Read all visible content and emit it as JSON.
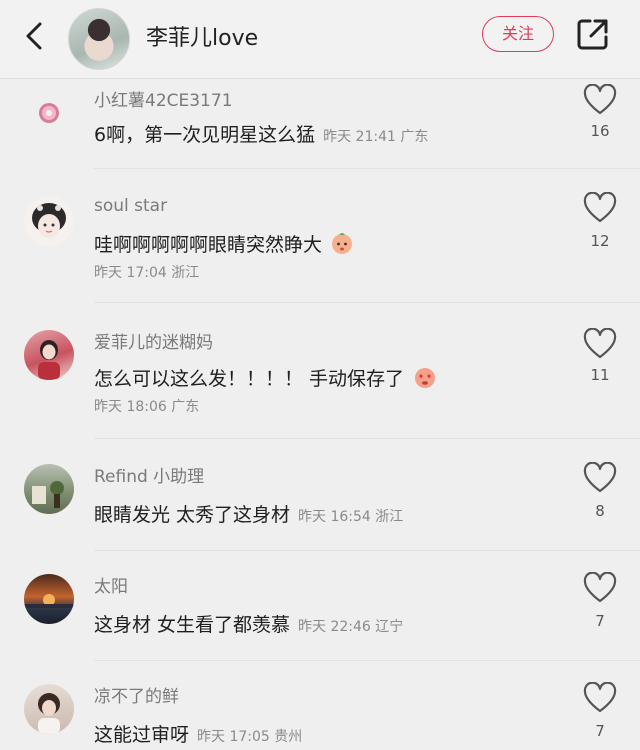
{
  "header": {
    "username": "李菲儿love",
    "follow_label": "关注"
  },
  "comments": [
    {
      "user": "小红薯42CE3171",
      "text": "6啊，第一次见明星这么猛",
      "time": "昨天 21:41 广东",
      "likes": "16"
    },
    {
      "user": "soul star",
      "text": "哇啊啊啊啊啊眼睛突然睁大",
      "time": "昨天 17:04 浙江",
      "likes": "12"
    },
    {
      "user": "爱菲儿的迷糊妈",
      "text": "怎么可以这么发！！！！ 手动保存了",
      "time": "昨天 18:06 广东",
      "likes": "11"
    },
    {
      "user": "Refind 小助理",
      "text": "眼睛发光 太秀了这身材",
      "time": "昨天 16:54 浙江",
      "likes": "8"
    },
    {
      "user": "太阳",
      "text": "这身材 女生看了都羡慕",
      "time": "昨天 22:46 辽宁",
      "likes": "7"
    },
    {
      "user": "凉不了的鲜",
      "text": "这能过审呀",
      "time": "昨天 17:05 贵州",
      "likes": "7"
    }
  ]
}
